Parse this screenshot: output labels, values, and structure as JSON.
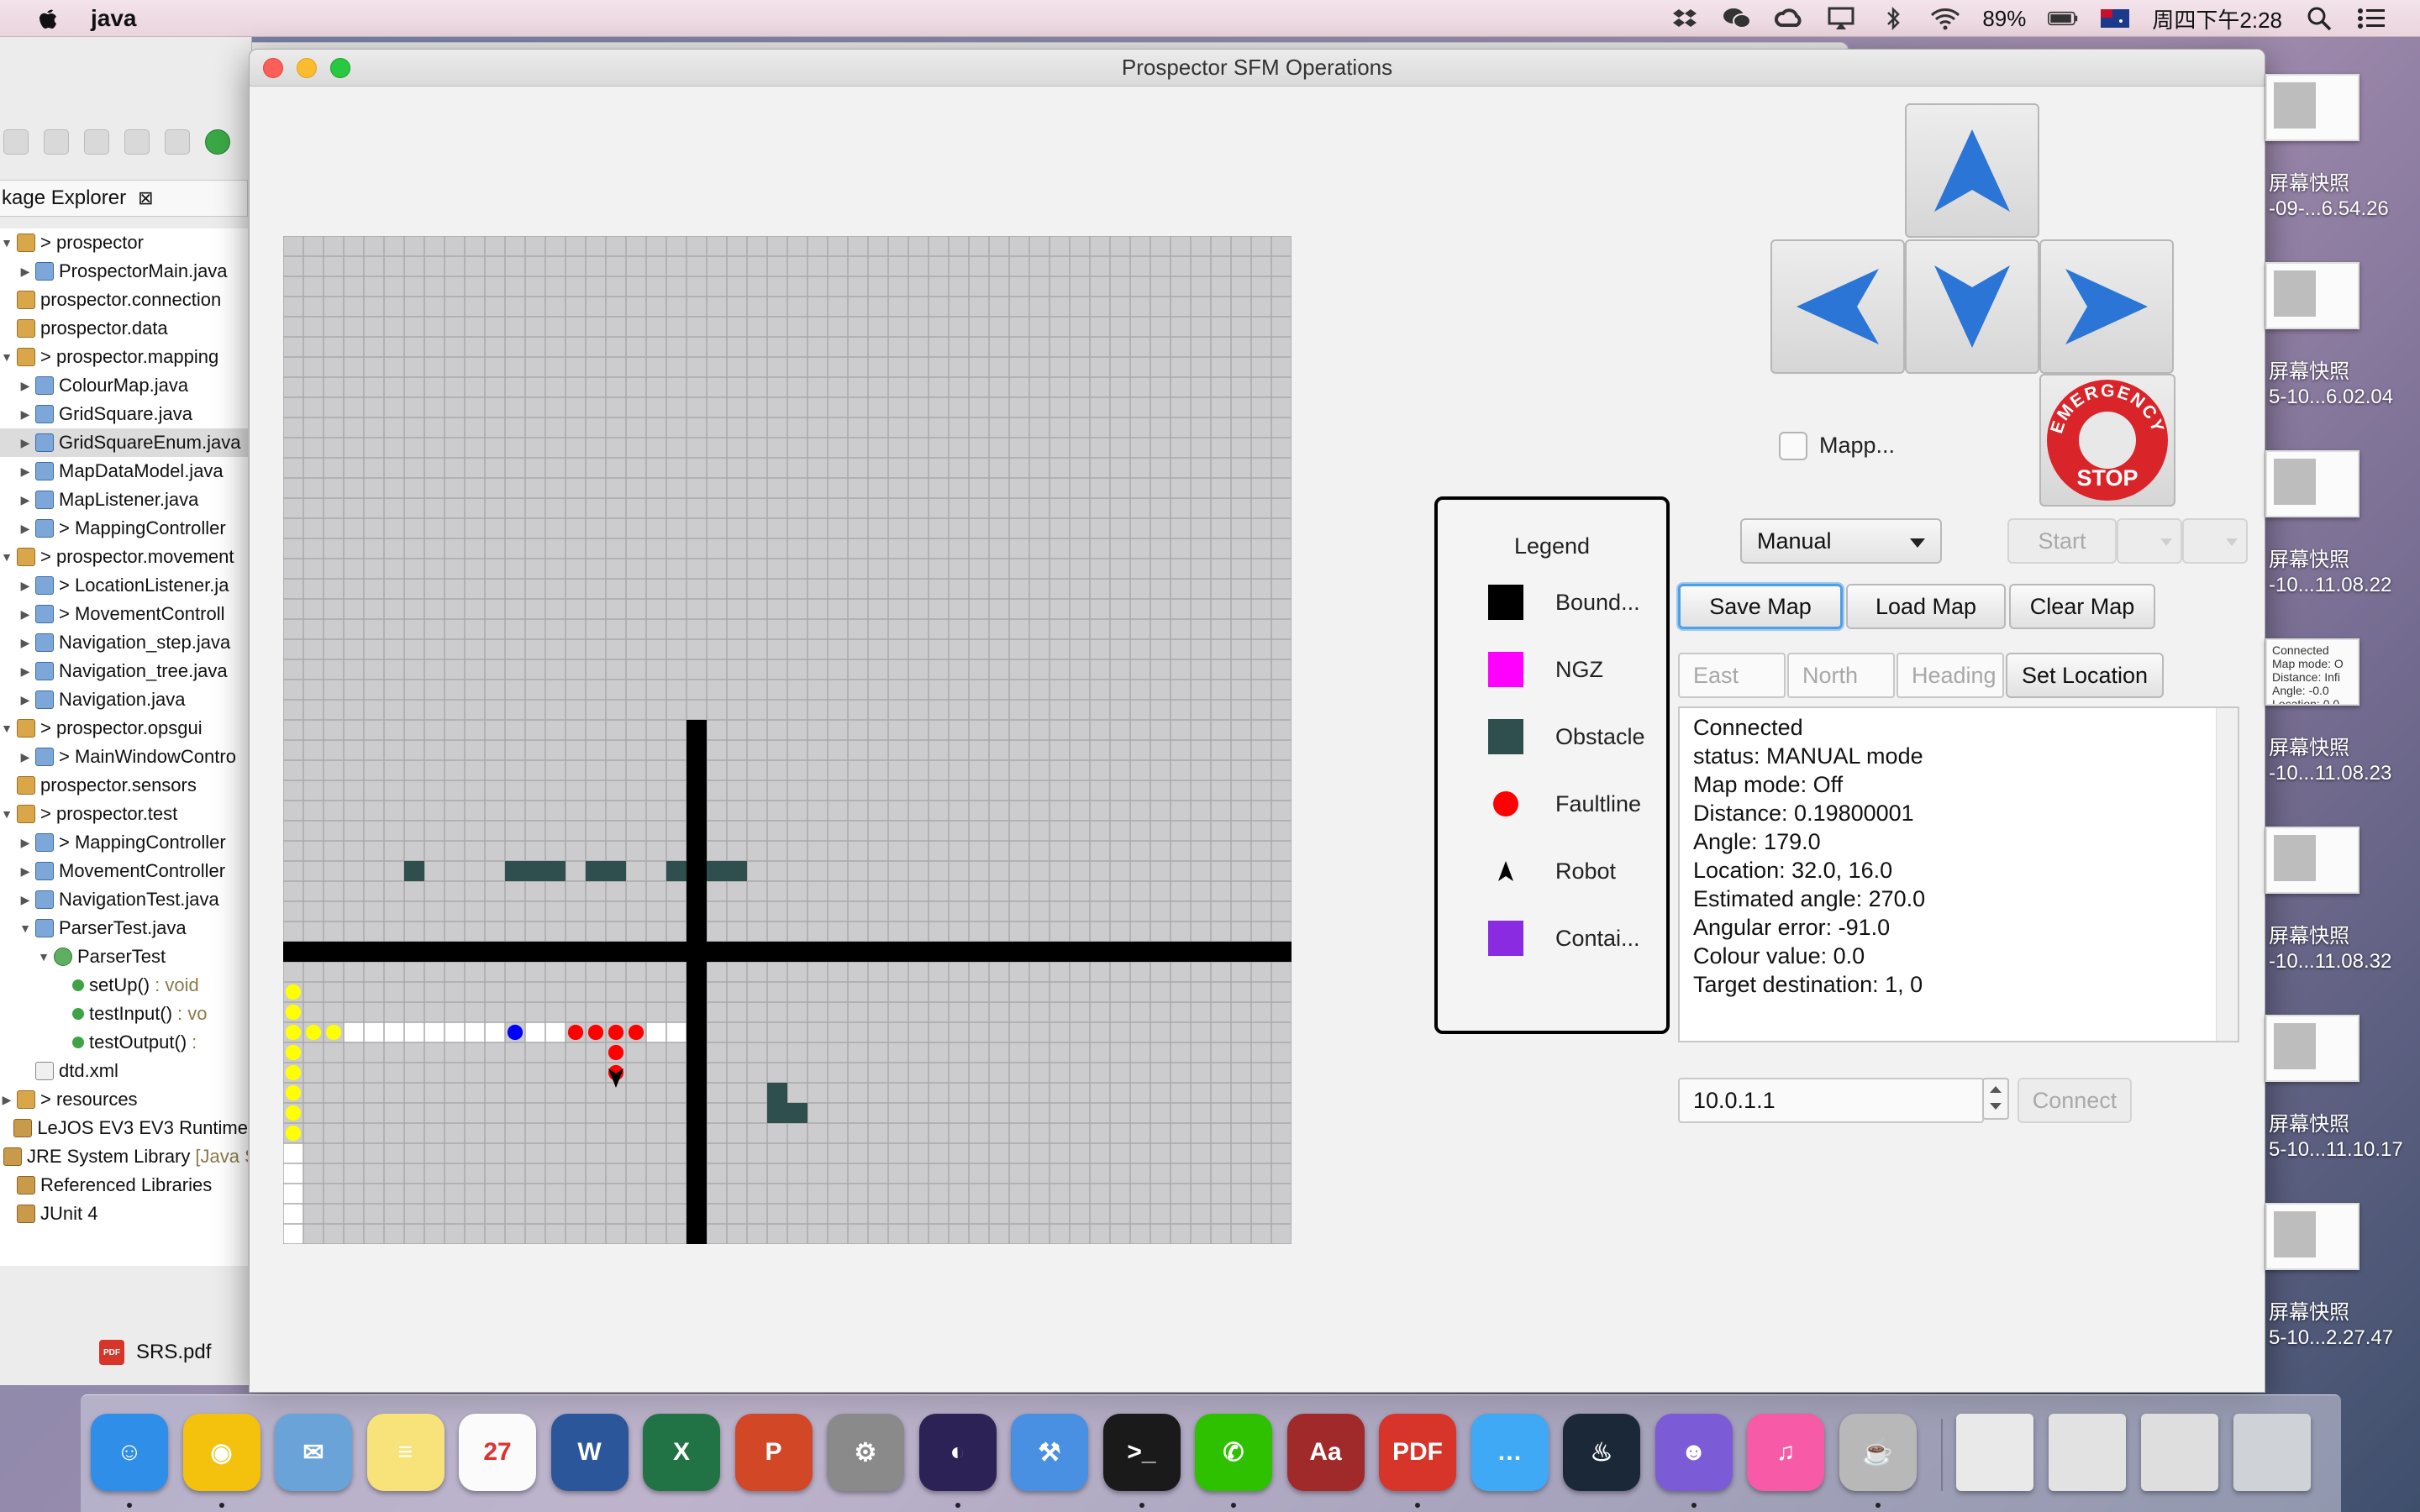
{
  "menubar": {
    "app_name": "java",
    "battery": "89%",
    "datetime": "周四下午2:28",
    "icons": [
      "dropbox-icon",
      "wechat-icon",
      "creative-cloud-icon",
      "airplay-icon",
      "bluetooth-icon",
      "wifi-icon",
      "battery-icon",
      "flag-icon",
      "spotlight-icon",
      "notification-icon"
    ]
  },
  "eclipse": {
    "tab_label": "kage Explorer",
    "tab_close": "⊠",
    "tree": [
      {
        "indent": 0,
        "tw": "▼",
        "icon": "pkg",
        "label": "> prospector"
      },
      {
        "indent": 1,
        "tw": "▶",
        "icon": "java",
        "label": "ProspectorMain.java"
      },
      {
        "indent": 0,
        "tw": "",
        "icon": "pkg",
        "label": "prospector.connection"
      },
      {
        "indent": 0,
        "tw": "",
        "icon": "pkg",
        "label": "prospector.data"
      },
      {
        "indent": 0,
        "tw": "▼",
        "icon": "pkg",
        "label": "> prospector.mapping"
      },
      {
        "indent": 1,
        "tw": "▶",
        "icon": "java",
        "label": "ColourMap.java"
      },
      {
        "indent": 1,
        "tw": "▶",
        "icon": "java",
        "label": "GridSquare.java"
      },
      {
        "indent": 1,
        "tw": "▶",
        "icon": "java",
        "label": "GridSquareEnum.java",
        "selected": true
      },
      {
        "indent": 1,
        "tw": "▶",
        "icon": "java",
        "label": "MapDataModel.java"
      },
      {
        "indent": 1,
        "tw": "▶",
        "icon": "java",
        "label": "MapListener.java"
      },
      {
        "indent": 1,
        "tw": "▶",
        "icon": "java",
        "label": "> MappingController"
      },
      {
        "indent": 0,
        "tw": "▼",
        "icon": "pkg",
        "label": "> prospector.movement"
      },
      {
        "indent": 1,
        "tw": "▶",
        "icon": "java",
        "label": "> LocationListener.ja"
      },
      {
        "indent": 1,
        "tw": "▶",
        "icon": "java",
        "label": "> MovementControll"
      },
      {
        "indent": 1,
        "tw": "▶",
        "icon": "java",
        "label": "Navigation_step.java"
      },
      {
        "indent": 1,
        "tw": "▶",
        "icon": "java",
        "label": "Navigation_tree.java"
      },
      {
        "indent": 1,
        "tw": "▶",
        "icon": "java",
        "label": "Navigation.java"
      },
      {
        "indent": 0,
        "tw": "▼",
        "icon": "pkg",
        "label": "> prospector.opsgui"
      },
      {
        "indent": 1,
        "tw": "▶",
        "icon": "java",
        "label": "> MainWindowContro"
      },
      {
        "indent": 0,
        "tw": "",
        "icon": "pkg",
        "label": "prospector.sensors"
      },
      {
        "indent": 0,
        "tw": "▼",
        "icon": "pkg",
        "label": "> prospector.test"
      },
      {
        "indent": 1,
        "tw": "▶",
        "icon": "java",
        "label": "> MappingController"
      },
      {
        "indent": 1,
        "tw": "▶",
        "icon": "java",
        "label": "MovementController"
      },
      {
        "indent": 1,
        "tw": "▶",
        "icon": "java",
        "label": "NavigationTest.java"
      },
      {
        "indent": 1,
        "tw": "▼",
        "icon": "java",
        "label": "ParserTest.java"
      },
      {
        "indent": 2,
        "tw": "▼",
        "icon": "test",
        "label": "ParserTest"
      },
      {
        "indent": 3,
        "tw": "",
        "icon": "method",
        "label": "setUp()",
        "sig": ": void"
      },
      {
        "indent": 3,
        "tw": "",
        "icon": "method",
        "label": "testInput()",
        "sig": ": vo"
      },
      {
        "indent": 3,
        "tw": "",
        "icon": "method",
        "label": "testOutput()",
        "sig": ":"
      },
      {
        "indent": 1,
        "tw": "",
        "icon": "xml",
        "label": "dtd.xml"
      },
      {
        "indent": 0,
        "tw": "▶",
        "icon": "pkg",
        "label": "> resources"
      },
      {
        "indent": 0,
        "tw": "",
        "icon": "lib",
        "label": "LeJOS EV3 EV3 Runtime"
      },
      {
        "indent": 0,
        "tw": "",
        "icon": "lib",
        "label": "JRE System Library",
        "sig": "[Java S"
      },
      {
        "indent": 0,
        "tw": "",
        "icon": "lib",
        "label": "Referenced Libraries"
      },
      {
        "indent": 0,
        "tw": "",
        "icon": "lib",
        "label": "JUnit 4"
      }
    ],
    "editor_tab": "SRS.pdf"
  },
  "window": {
    "title": "Prospector SFM Operations"
  },
  "map": {
    "cols": 50,
    "rows": 50,
    "colors": {
      "bg": "#ccccce",
      "grid": "#a9a9aa",
      "boundary": "#000000",
      "obstacle": "#2f4f4f",
      "faultline": "#ff0000",
      "yellow": "#ffff00",
      "blue": "#0000ff",
      "white": "#ffffff"
    },
    "obstacles": [
      [
        6,
        31
      ],
      [
        11,
        31
      ],
      [
        12,
        31
      ],
      [
        13,
        31
      ],
      [
        15,
        31
      ],
      [
        16,
        31
      ],
      [
        19,
        31
      ],
      [
        21,
        31
      ],
      [
        22,
        31
      ],
      [
        24,
        42
      ],
      [
        24,
        43
      ],
      [
        25,
        43
      ]
    ],
    "faultlines": [
      [
        14,
        39
      ],
      [
        15,
        39
      ],
      [
        16,
        39
      ],
      [
        17,
        39
      ],
      [
        16,
        40
      ],
      [
        16,
        41
      ]
    ],
    "yellow_dots": [
      [
        0,
        37
      ],
      [
        0,
        38
      ],
      [
        0,
        39
      ],
      [
        0,
        40
      ],
      [
        0,
        41
      ],
      [
        0,
        42
      ],
      [
        0,
        43
      ],
      [
        0,
        44
      ],
      [
        1,
        39
      ],
      [
        2,
        39
      ]
    ],
    "blue_dots": [
      [
        11,
        39
      ]
    ],
    "white_cells_row": 39,
    "white_cells_cols": [
      3,
      4,
      5,
      6,
      7,
      8,
      9,
      10,
      12,
      13,
      18,
      19
    ],
    "white_col_zero_rows": [
      45,
      46,
      47,
      48,
      49
    ],
    "robot": {
      "col": 16,
      "row": 41,
      "heading": 270.0
    }
  },
  "legend": {
    "title": "Legend",
    "items": [
      {
        "label": "Bound...",
        "color": "#000000",
        "shape": "square"
      },
      {
        "label": "NGZ",
        "color": "#ff00ff",
        "shape": "square"
      },
      {
        "label": "Obstacle",
        "color": "#2f4f4f",
        "shape": "square"
      },
      {
        "label": "Faultline",
        "color": "#ff0000",
        "shape": "circle"
      },
      {
        "label": "Robot",
        "color": "#000000",
        "shape": "robot"
      },
      {
        "label": "Contai...",
        "color": "#8a2be2",
        "shape": "square"
      }
    ]
  },
  "controls": {
    "emergency_top": "EMERGENCY",
    "emergency_bottom": "STOP",
    "map_mode_label": "Mapp...",
    "mode_selected": "Manual",
    "start_label": "Start",
    "save_map": "Save Map",
    "load_map": "Load Map",
    "clear_map": "Clear Map",
    "east_placeholder": "East",
    "north_placeholder": "North",
    "heading_placeholder": "Heading",
    "set_location": "Set Location",
    "ip_value": "10.0.1.1",
    "connect": "Connect",
    "arrow_color": "#2a75d6"
  },
  "status_lines": [
    "Connected",
    "status: MANUAL mode",
    "Map mode: Off",
    "Distance: 0.19800001",
    "Angle: 179.0",
    "Location: 32.0, 16.0",
    "Estimated angle: 270.0",
    "Angular error: -91.0",
    "Colour value: 0.0",
    "Target destination:  1, 0"
  ],
  "thumbnails": [
    {
      "label1": "屏幕快照",
      "label2": "-09-...6.54.26"
    },
    {
      "label1": "屏幕快照",
      "label2": "5-10...6.02.04"
    },
    {
      "label1": "屏幕快照",
      "label2": "-10...11.08.22"
    },
    {
      "label1": "屏幕快照",
      "label2": "-10...11.08.23",
      "text": "Connected\nMap mode: O\nDistance: Infi\nAngle: -0.0\nLocation: 0.0,"
    },
    {
      "label1": "屏幕快照",
      "label2": "-10...11.08.32"
    },
    {
      "label1": "屏幕快照",
      "label2": "5-10...11.10.17"
    },
    {
      "label1": "屏幕快照",
      "label2": "5-10...2.27.47"
    }
  ],
  "dock": {
    "apps": [
      {
        "name": "finder",
        "color": "#2f8fe8",
        "glyph": "☺"
      },
      {
        "name": "chrome",
        "color": "#f4c20d",
        "glyph": "◉"
      },
      {
        "name": "mail",
        "color": "#6aa3d8",
        "glyph": "✉"
      },
      {
        "name": "notes",
        "color": "#f8e37a",
        "glyph": "≡"
      },
      {
        "name": "calendar",
        "color": "#fbfbfb",
        "glyph": "27",
        "dark": true
      },
      {
        "name": "word",
        "color": "#2b579a",
        "glyph": "W"
      },
      {
        "name": "excel",
        "color": "#217346",
        "glyph": "X"
      },
      {
        "name": "powerpoint",
        "color": "#d24726",
        "glyph": "P"
      },
      {
        "name": "system-preferences",
        "color": "#8a8a8a",
        "glyph": "⚙"
      },
      {
        "name": "eclipse",
        "color": "#2c2255",
        "glyph": "◐"
      },
      {
        "name": "xcode",
        "color": "#4a90e2",
        "glyph": "⚒"
      },
      {
        "name": "terminal",
        "color": "#1a1a1a",
        "glyph": ">_"
      },
      {
        "name": "wechat",
        "color": "#2dc100",
        "glyph": "✆"
      },
      {
        "name": "dictionary",
        "color": "#a02a2a",
        "glyph": "Aa"
      },
      {
        "name": "pdf-expert",
        "color": "#d8352a",
        "glyph": "PDF"
      },
      {
        "name": "messages",
        "color": "#3fa9f5",
        "glyph": "…"
      },
      {
        "name": "steam",
        "color": "#1b2838",
        "glyph": "♨"
      },
      {
        "name": "github",
        "color": "#7b5bd6",
        "glyph": "☻"
      },
      {
        "name": "itunes",
        "color": "#f75aa6",
        "glyph": "♫"
      },
      {
        "name": "preview",
        "color": "#b8b8b8",
        "glyph": "☕"
      }
    ],
    "running_dots": [
      0,
      1,
      9,
      11,
      12,
      14,
      17,
      19
    ],
    "stack_items": [
      {
        "name": "stack-item-1",
        "color": "#e9e9e9"
      },
      {
        "name": "stack-item-2",
        "color": "#e2e2e2"
      },
      {
        "name": "stack-item-3",
        "color": "#dedede"
      },
      {
        "name": "trash",
        "color": "#cfd3d8"
      }
    ]
  }
}
